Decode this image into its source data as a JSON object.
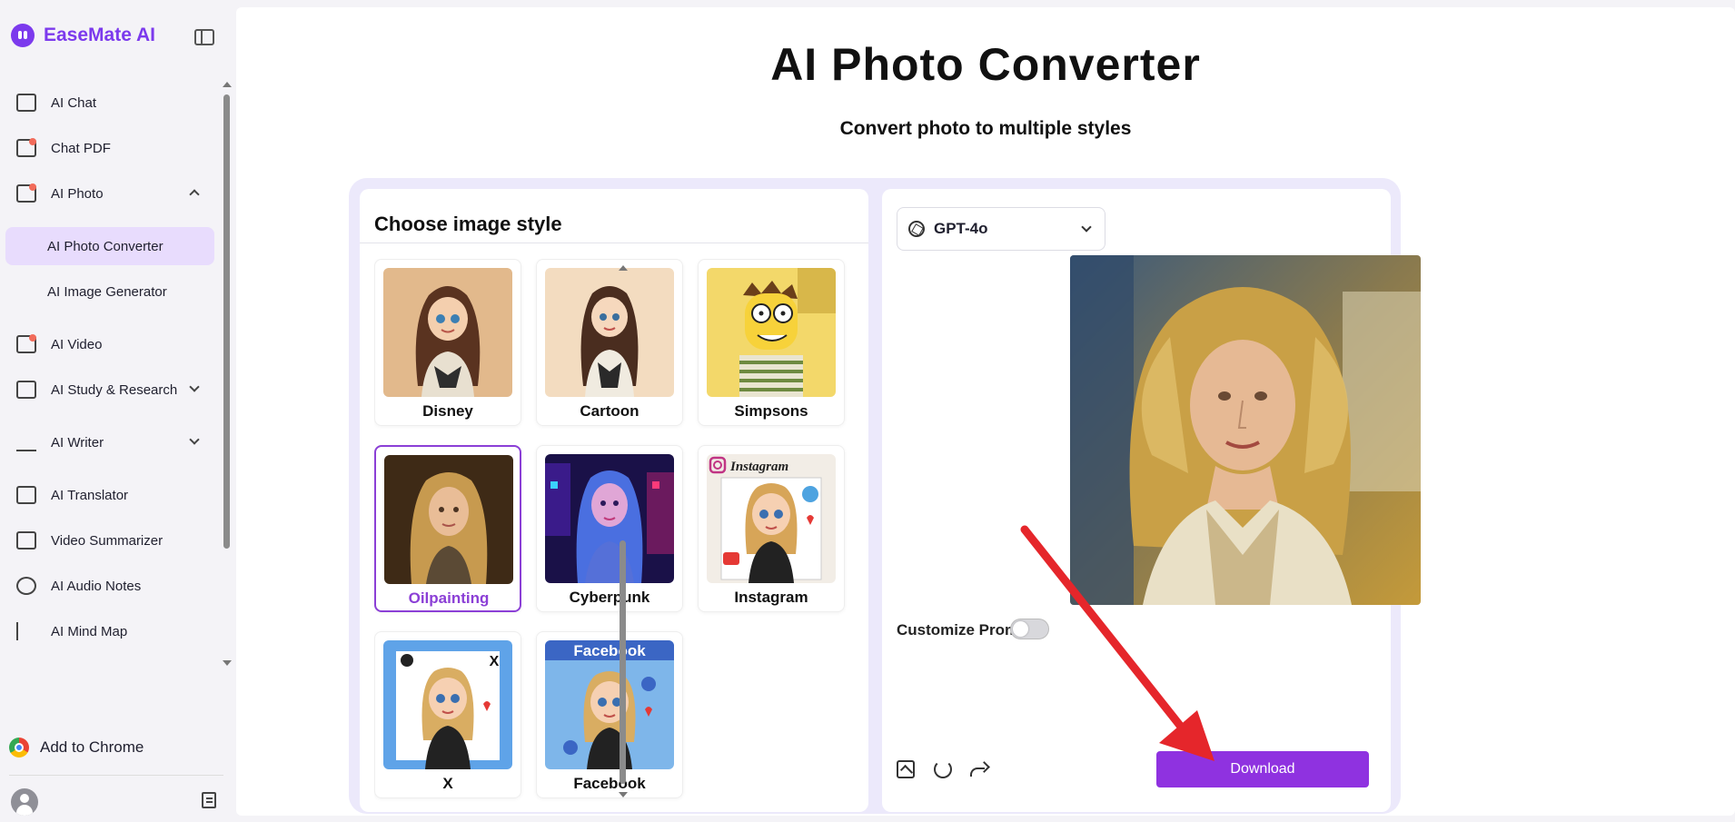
{
  "brand": {
    "name": "EaseMate AI"
  },
  "sidebar": {
    "items": [
      {
        "label": "AI Chat",
        "icon": "chat-icon"
      },
      {
        "label": "Chat PDF",
        "icon": "pdf-icon"
      },
      {
        "label": "AI Photo",
        "icon": "photo-icon"
      },
      {
        "label": "AI Photo Converter"
      },
      {
        "label": "AI Image Generator"
      },
      {
        "label": "AI Video",
        "icon": "video-icon"
      },
      {
        "label": "AI Study & Research",
        "icon": "study-icon"
      },
      {
        "label": "AI Writer",
        "icon": "writer-icon"
      },
      {
        "label": "AI Translator",
        "icon": "translate-icon"
      },
      {
        "label": "Video Summarizer",
        "icon": "video-summary-icon"
      },
      {
        "label": "AI Audio Notes",
        "icon": "audio-icon"
      },
      {
        "label": "AI Mind Map",
        "icon": "mindmap-icon"
      }
    ],
    "add_to_chrome": "Add to Chrome"
  },
  "header": {
    "title": "AI Photo Converter",
    "subtitle": "Convert photo to multiple styles"
  },
  "styles_panel": {
    "title": "Choose image style",
    "styles": [
      "Disney",
      "Cartoon",
      "Simpsons",
      "Oilpainting",
      "Cyberpunk",
      "Instagram",
      "X",
      "Facebook"
    ],
    "selected": "Oilpainting"
  },
  "result_panel": {
    "model": "GPT-4o",
    "customize_prompt_label": "Customize Prompt",
    "customize_prompt_enabled": false,
    "download_label": "Download",
    "accent_color": "#8f32e0"
  },
  "thumb_text": {
    "instagram": "Instagram",
    "facebook": "Facebook",
    "x": "X"
  }
}
